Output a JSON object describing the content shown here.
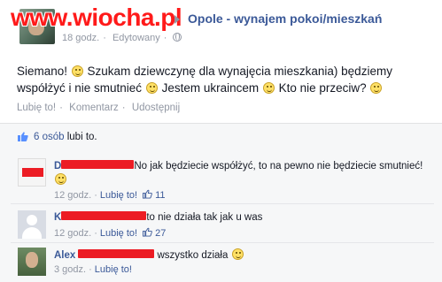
{
  "watermark": "www.wiocha.pl",
  "post": {
    "group_name": "Opole - wynajem pokoi/mieszkań",
    "time": "18 godz.",
    "edited": "Edytowany",
    "body_1": "Siemano! ",
    "body_2": " Szukam dziewczynę dla wynajęcia mieszkania) będziemy współżyć i nie smutnieć ",
    "body_3": " Jestem ukraincem ",
    "body_4": " Kto nie przeciw? ",
    "actions": [
      "Lubię to!",
      "Komentarz",
      "Udostępnij"
    ],
    "likes": {
      "count": "6 osób",
      "suffix": "lubi to."
    }
  },
  "comments": [
    {
      "name": "D",
      "text": "No jak będziecie współżyć, to na pewno nie będziecie smutnieć! ",
      "time": "12 godz.",
      "like_label": "Lubię to!",
      "like_count": "11"
    },
    {
      "name": "K",
      "text": "to nie działa tak jak u was",
      "time": "12 godz.",
      "like_label": "Lubię to!",
      "like_count": "27"
    },
    {
      "name": "Alex",
      "text": "wszystko działa ",
      "time": "3 godz.",
      "like_label": "Lubię to!"
    }
  ],
  "colors": {
    "link": "#3b5998",
    "meta": "#9197a3",
    "redaction": "#ec1c24",
    "watermark": "#ff1a1a"
  }
}
